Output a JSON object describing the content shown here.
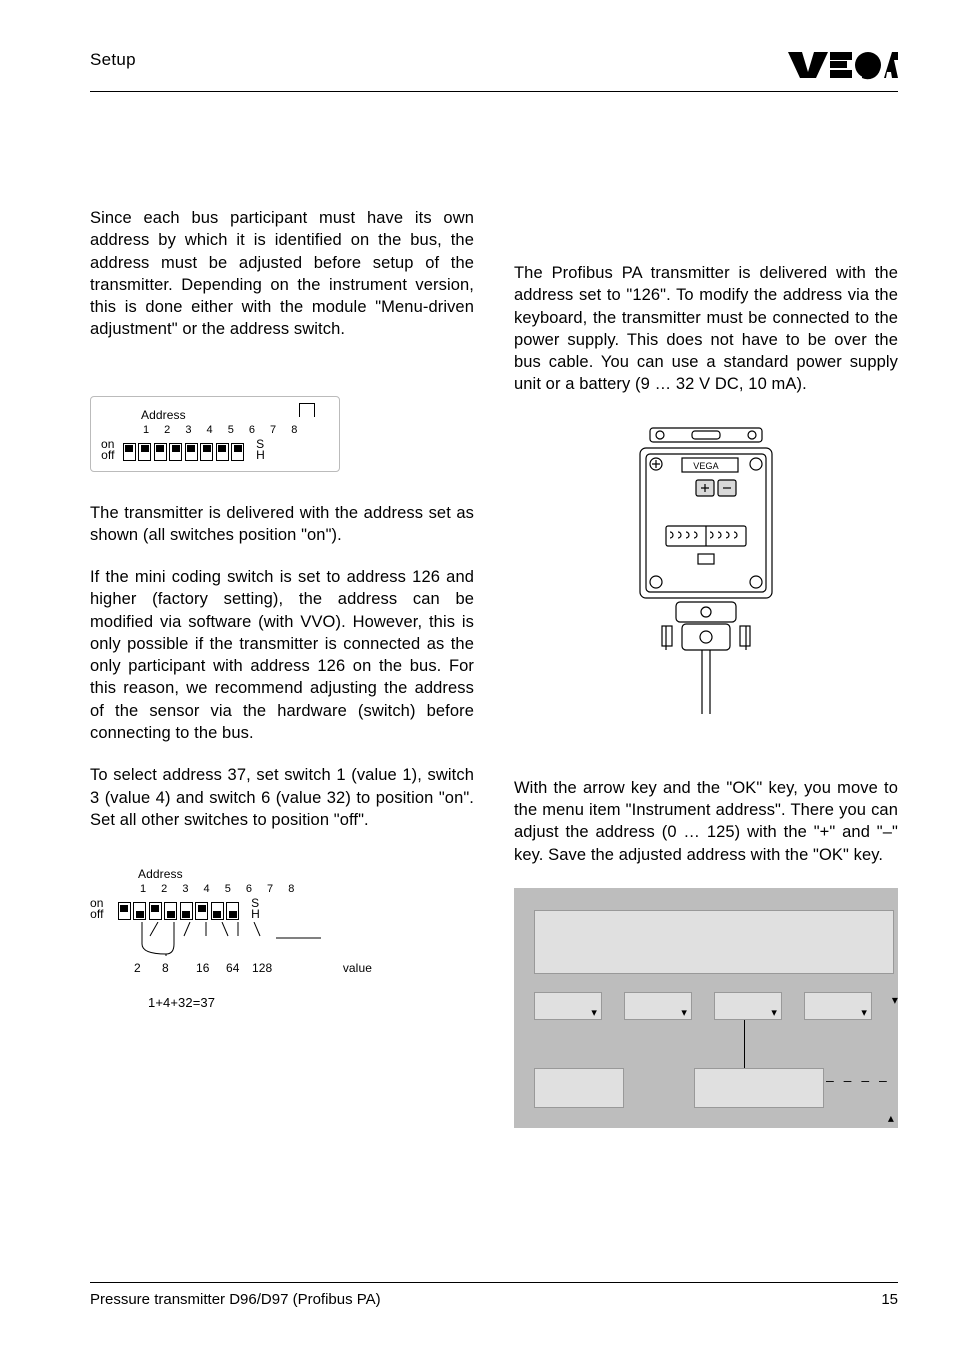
{
  "header": {
    "section": "Setup",
    "logo_text": "VEGA"
  },
  "left": {
    "p1": "Since each bus participant must have its own address by which it is identified on the bus, the address must be adjusted before setup of the transmitter. Depending on the instrument version, this is done either with the module \"Menu-driven adjustment\" or the address switch.",
    "dip1": {
      "title": "Address",
      "numbers": "1 2 3 4 5 6 7 8",
      "on": "on",
      "off": "off",
      "S": "S",
      "H": "H"
    },
    "p2": "The transmitter is delivered with the address set as shown (all switches position \"on\").",
    "p3": "If the mini coding switch is set to address 126 and higher (factory setting), the address can be modified via software (with VVO). However, this is only possible if the transmitter is connected as the only participant with address 126 on the bus. For this reason, we recommend adjusting the address of the sensor via the hardware (switch) before connecting to the bus.",
    "p4": "To select address 37, set switch 1 (value 1), switch 3 (value 4) and switch 6 (value 32) to position \"on\". Set all other switches to position \"off\".",
    "dip2": {
      "title": "Address",
      "numbers": "1 2 3 4 5 6 7 8",
      "on": "on",
      "off": "off",
      "S": "S",
      "H": "H",
      "v2": "2",
      "v8": "8",
      "v16": "16",
      "v64": "64",
      "v128": "128",
      "value_label": "value",
      "formula": "1+4+32=37"
    }
  },
  "right": {
    "p1": "The Profibus PA transmitter is delivered with the address set to \"126\". To modify the address via the keyboard, the transmitter must be connected to the power supply. This does not have to be over the bus cable. You can use a standard power supply unit or a battery (9 … 32 V DC,  10 mA).",
    "device_logo": "VEGA",
    "p2": "With the arrow key and the \"OK\" key, you move to the menu item \"Instrument address\". There you can adjust the address (0 … 125) with the \"+\" and \"–\" key. Save the adjusted address with the \"OK\" key.",
    "lcd_dashes": "– – – –"
  },
  "footer": {
    "doc": "Pressure transmitter D96/D97 (Profibus PA)",
    "page": "15"
  }
}
